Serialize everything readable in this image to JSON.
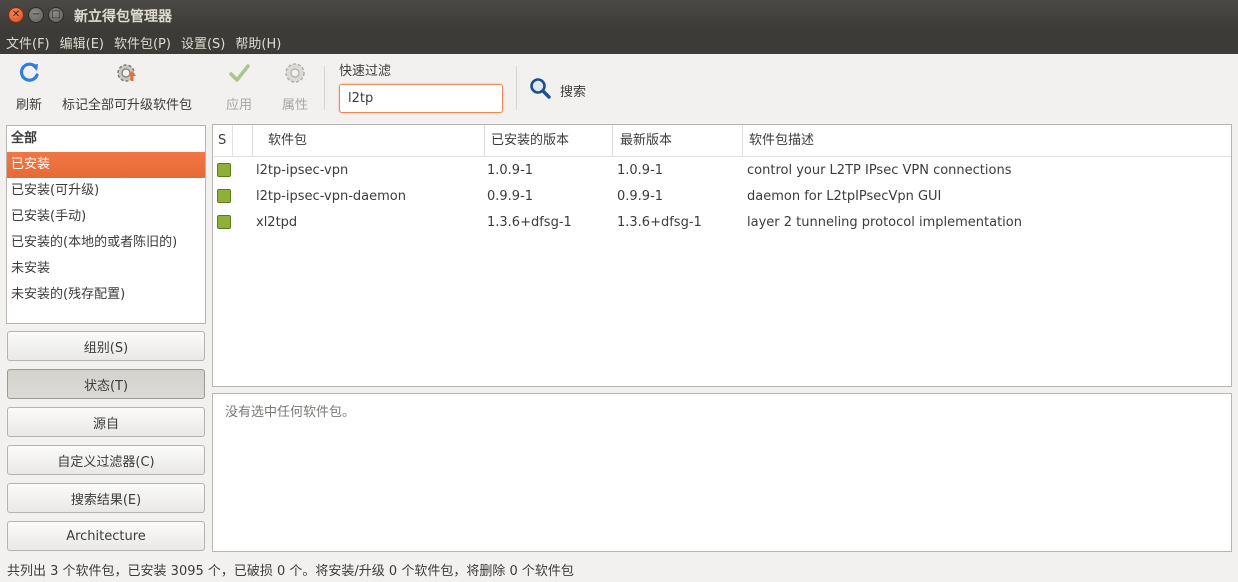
{
  "window": {
    "title": "新立得包管理器"
  },
  "menu": [
    "文件(F)",
    "编辑(E)",
    "软件包(P)",
    "设置(S)",
    "帮助(H)"
  ],
  "toolbar": {
    "refresh": "刷新",
    "mark_all_upgrades": "标记全部可升级软件包",
    "apply": "应用",
    "properties": "属性",
    "quick_filter_label": "快速过滤",
    "quick_filter_value": "l2tp",
    "search": "搜索"
  },
  "filters": {
    "header": "全部",
    "items": [
      "已安装",
      "已安装(可升级)",
      "已安装(手动)",
      "已安装的(本地的或者陈旧的)",
      "未安装",
      "未安装的(残存配置)"
    ],
    "selected": "已安装"
  },
  "side_buttons": [
    "组别(S)",
    "状态(T)",
    "源自",
    "自定义过滤器(C)",
    "搜索结果(E)",
    "Architecture"
  ],
  "active_side_button": "状态(T)",
  "table": {
    "columns": [
      "S",
      "",
      "软件包",
      "已安装的版本",
      "最新版本",
      "软件包描述"
    ],
    "rows": [
      {
        "name": "l2tp-ipsec-vpn",
        "installed": "1.0.9-1",
        "latest": "1.0.9-1",
        "description": "control your L2TP IPsec VPN connections"
      },
      {
        "name": "l2tp-ipsec-vpn-daemon",
        "installed": "0.9.9-1",
        "latest": "0.9.9-1",
        "description": "daemon for L2tpIPsecVpn GUI"
      },
      {
        "name": "xl2tpd",
        "installed": "1.3.6+dfsg-1",
        "latest": "1.3.6+dfsg-1",
        "description": "layer 2 tunneling protocol implementation"
      }
    ],
    "status_color": "#8fb13a"
  },
  "details": {
    "empty_text": "没有选中任何软件包。"
  },
  "statusbar": "共列出 3 个软件包，已安装 3095 个，已破损 0 个。将安装/升级 0 个软件包，将删除 0 个软件包",
  "colors": {
    "accent": "#e66a35",
    "titlebar": "#3c3b37"
  }
}
